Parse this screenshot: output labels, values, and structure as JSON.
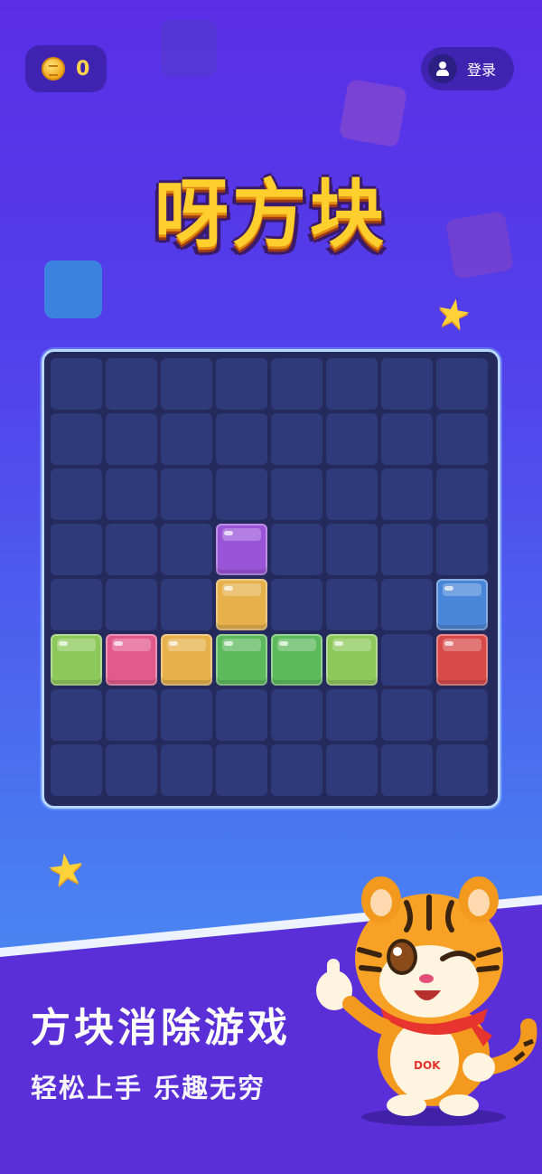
{
  "header": {
    "coins": "0",
    "login_label": "登录"
  },
  "title": "呀方块",
  "board": {
    "rows": 8,
    "cols": 8,
    "blocks": [
      {
        "row": 3,
        "col": 3,
        "color": "#9a54d8"
      },
      {
        "row": 4,
        "col": 3,
        "color": "#e6b04a"
      },
      {
        "row": 4,
        "col": 7,
        "color": "#4a86d8"
      },
      {
        "row": 5,
        "col": 0,
        "color": "#8cc85a"
      },
      {
        "row": 5,
        "col": 1,
        "color": "#e25a8a"
      },
      {
        "row": 5,
        "col": 2,
        "color": "#e6b04a"
      },
      {
        "row": 5,
        "col": 3,
        "color": "#5cba5c"
      },
      {
        "row": 5,
        "col": 4,
        "color": "#5cba5c"
      },
      {
        "row": 5,
        "col": 5,
        "color": "#8cc85a"
      },
      {
        "row": 5,
        "col": 7,
        "color": "#d84a4a"
      }
    ]
  },
  "slogan": {
    "main": "方块消除游戏",
    "sub": "轻松上手 乐趣无穷"
  },
  "mascot": {
    "badge": "DOK"
  },
  "icons": [
    "coin-icon",
    "user-icon",
    "star-icon",
    "tiger-mascot"
  ],
  "colors": {
    "accent_gold": "#ffcf2e",
    "board_bg": "#242a5c",
    "cell_empty": "#2f3a7a"
  }
}
